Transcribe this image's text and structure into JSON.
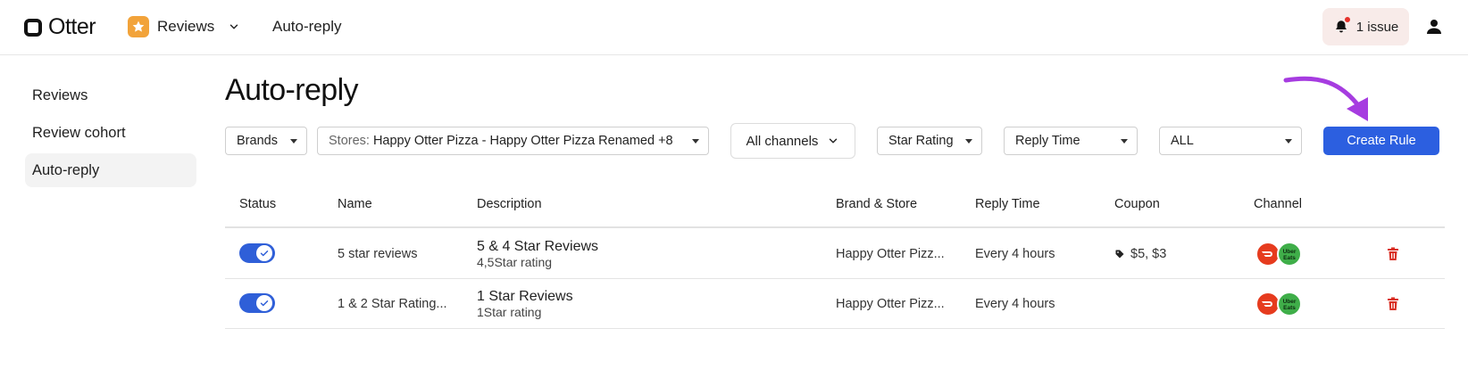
{
  "header": {
    "logo_text": "Otter",
    "app_name": "Reviews",
    "breadcrumb": "Auto-reply",
    "issue_label": "1 issue"
  },
  "sidebar": {
    "items": [
      {
        "label": "Reviews",
        "active": false
      },
      {
        "label": "Review cohort",
        "active": false
      },
      {
        "label": "Auto-reply",
        "active": true
      }
    ]
  },
  "page": {
    "title": "Auto-reply"
  },
  "filters": {
    "brands": "Brands",
    "stores_prefix": "Stores:",
    "stores_value": "Happy Otter Pizza - Happy Otter Pizza Renamed +8",
    "channels": "All channels",
    "star_rating": "Star Rating",
    "reply_time": "Reply Time",
    "all": "ALL",
    "create_rule": "Create Rule"
  },
  "table": {
    "headers": [
      "Status",
      "Name",
      "Description",
      "Brand & Store",
      "Reply Time",
      "Coupon",
      "Channel"
    ],
    "rows": [
      {
        "enabled": true,
        "name": "5 star reviews",
        "desc_title": "5 & 4 Star Reviews",
        "desc_sub": "4,5Star rating",
        "brand_store": "Happy Otter Pizz...",
        "reply_time": "Every 4 hours",
        "coupon": "$5, $3",
        "channels": [
          "doordash",
          "uber-eats"
        ]
      },
      {
        "enabled": true,
        "name": "1 & 2 Star Rating...",
        "desc_title": "1 Star Reviews",
        "desc_sub": "1Star rating",
        "brand_store": "Happy Otter Pizz...",
        "reply_time": "Every 4 hours",
        "coupon": "",
        "channels": [
          "doordash",
          "uber-eats"
        ]
      }
    ],
    "uber_badge_text": "Uber Eats"
  },
  "colors": {
    "primary": "#2c5fe0",
    "toggle_on": "#2f5fd8",
    "issue_bg": "#f8ebe9",
    "app_icon": "#f2a33a",
    "doordash": "#e63b1e",
    "uber_eats": "#3fae49",
    "delete": "#d93025",
    "annotation_arrow": "#a63ce0"
  }
}
